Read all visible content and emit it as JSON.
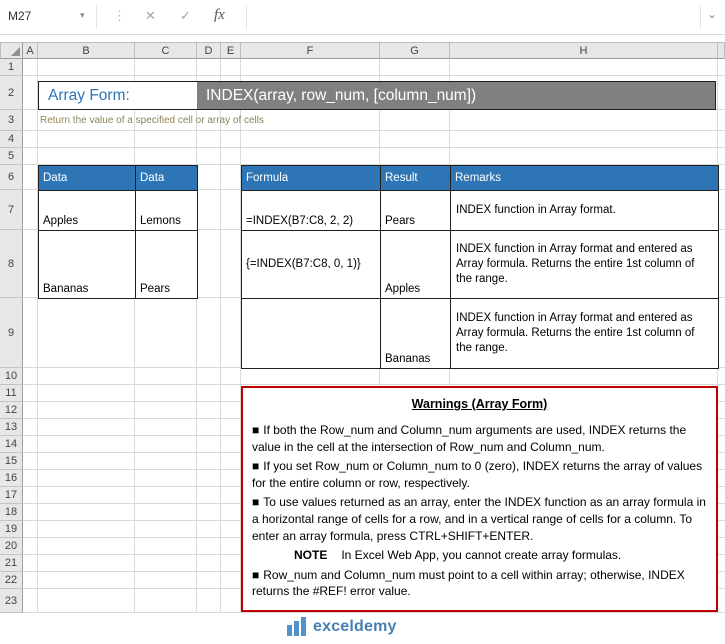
{
  "formula_bar": {
    "name_box_value": "M27",
    "chevron": "▾",
    "dots_icon": "⋮",
    "cancel_icon": "✕",
    "enter_icon": "✓",
    "fx_icon": "fx",
    "expand_icon": "⌄",
    "formula_value": ""
  },
  "grid": {
    "column_headers": [
      "A",
      "B",
      "C",
      "D",
      "E",
      "F",
      "G",
      "H"
    ],
    "row_numbers": [
      "1",
      "2",
      "3",
      "4",
      "5",
      "6",
      "7",
      "8",
      "9",
      "10",
      "11",
      "12",
      "13",
      "14",
      "15",
      "16",
      "17",
      "18",
      "19",
      "20",
      "21",
      "22",
      "23"
    ]
  },
  "banner": {
    "label": "Array Form:",
    "syntax": "INDEX(array, row_num, [column_num])"
  },
  "subtitle": "Return the value of a specified cell or array of cells",
  "data_table": {
    "headers": [
      "Data",
      "Data"
    ],
    "rows": [
      [
        "Apples",
        "Lemons"
      ],
      [
        "Bananas",
        "Pears"
      ]
    ]
  },
  "formula_table": {
    "headers": [
      "Formula",
      "Result",
      "Remarks"
    ],
    "rows": [
      {
        "formula": "=INDEX(B7:C8, 2, 2)",
        "result": "Pears",
        "remarks": "INDEX function in Array format."
      },
      {
        "formula": "{=INDEX(B7:C8, 0, 1)}",
        "result": "Apples",
        "remarks": "INDEX function in Array format and entered as Array formula. Returns the entire 1st column of the range."
      },
      {
        "formula": "",
        "result": "Bananas",
        "remarks": "INDEX function in Array format and entered as Array formula. Returns the entire 1st column of the range."
      }
    ]
  },
  "warnings": {
    "title": "Warnings (Array Form)",
    "bullet": "■",
    "items": [
      "If both the Row_num and Column_num arguments are used, INDEX returns the value in the cell at the intersection of Row_num and Column_num.",
      "If you set Row_num or Column_num to 0 (zero), INDEX returns the array of values for the entire column or row, respectively.",
      "To use values returned as an array, enter the INDEX function as an array formula in a horizontal range of cells for a row, and in a vertical range of cells for a column. To enter an array formula, press CTRL+SHIFT+ENTER."
    ],
    "note_label": "NOTE",
    "note_text": "In Excel Web App, you cannot create array formulas.",
    "final_item": "Row_num and Column_num must point to a cell within array; otherwise, INDEX returns the #REF! error value."
  },
  "watermark": {
    "text": "exceldemy"
  },
  "colors": {
    "accent_blue": "#2E75B6",
    "banner_gray": "#808080",
    "warning_border": "#C00000",
    "watermark_blue": "#1e63a4"
  }
}
